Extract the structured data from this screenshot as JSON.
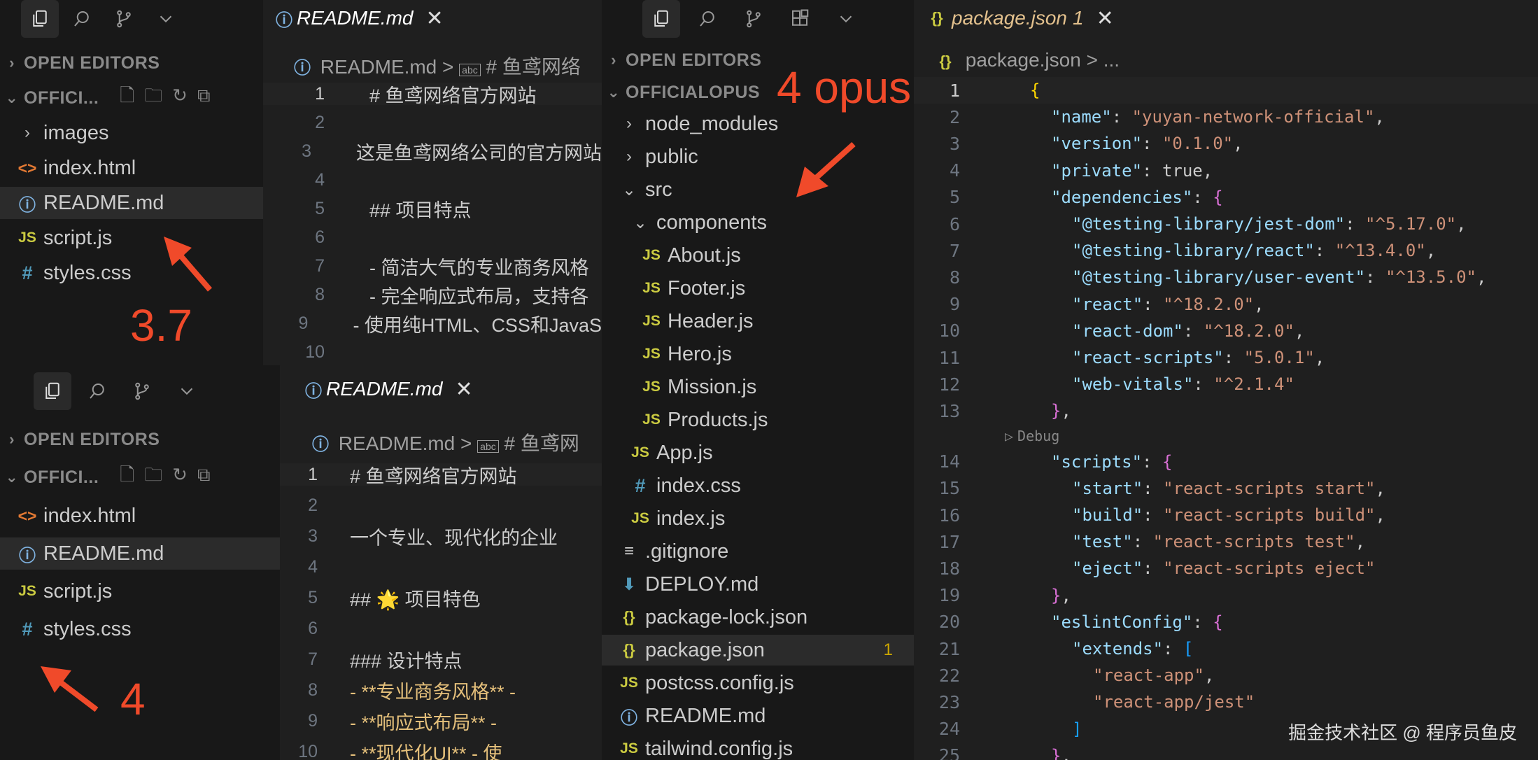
{
  "top_left": {
    "section_open_editors": "OPEN EDITORS",
    "section_folder": "OFFICI...",
    "files": [
      {
        "icon": "folder",
        "label": "images",
        "chev": "›"
      },
      {
        "icon": "html",
        "label": "index.html"
      },
      {
        "icon": "info",
        "label": "README.md",
        "selected": true
      },
      {
        "icon": "js",
        "label": "script.js"
      },
      {
        "icon": "css",
        "label": "styles.css"
      }
    ],
    "annotation": "3.7",
    "tab_label": "README.md",
    "breadcrumb_file": "README.md",
    "breadcrumb_sep": ">",
    "breadcrumb_heading": "# 鱼鸢网络",
    "lines": [
      {
        "n": "1",
        "t": "# 鱼鸢网络官方网站"
      },
      {
        "n": "2",
        "t": ""
      },
      {
        "n": "3",
        "t": "这是鱼鸢网络公司的官方网站"
      },
      {
        "n": "4",
        "t": ""
      },
      {
        "n": "5",
        "t": "## 项目特点"
      },
      {
        "n": "6",
        "t": ""
      },
      {
        "n": "7",
        "t": "- 简洁大气的专业商务风格"
      },
      {
        "n": "8",
        "t": "- 完全响应式布局，支持各"
      },
      {
        "n": "9",
        "t": "- 使用纯HTML、CSS和JavaS"
      },
      {
        "n": "10",
        "t": ""
      }
    ]
  },
  "bottom_left": {
    "section_open_editors": "OPEN EDITORS",
    "section_folder": "OFFICI...",
    "files": [
      {
        "icon": "html",
        "label": "index.html"
      },
      {
        "icon": "info",
        "label": "README.md",
        "selected": true
      },
      {
        "icon": "js",
        "label": "script.js"
      },
      {
        "icon": "css",
        "label": "styles.css"
      }
    ],
    "annotation": "4",
    "tab_label": "README.md",
    "breadcrumb_file": "README.md",
    "breadcrumb_sep": ">",
    "breadcrumb_heading": "# 鱼鸢网",
    "lines": [
      {
        "n": "1",
        "t": "# 鱼鸢网络官方网站"
      },
      {
        "n": "2",
        "t": ""
      },
      {
        "n": "3",
        "t": "一个专业、现代化的企业"
      },
      {
        "n": "4",
        "t": ""
      },
      {
        "n": "5",
        "t": "## 🌟 项目特色"
      },
      {
        "n": "6",
        "t": ""
      },
      {
        "n": "7",
        "t": "### 设计特点"
      },
      {
        "n": "8",
        "t": "- **专业商务风格** -"
      },
      {
        "n": "9",
        "t": "- **响应式布局** -"
      },
      {
        "n": "10",
        "t": "- **现代化UI** - 使"
      }
    ]
  },
  "right": {
    "section_open_editors": "OPEN EDITORS",
    "section_folder": "OFFICIALOPUS",
    "annotation": "4 opus",
    "tree": [
      {
        "icon": "folder",
        "label": "node_modules",
        "chev": "›",
        "depth": 0
      },
      {
        "icon": "folder",
        "label": "public",
        "chev": "›",
        "depth": 0
      },
      {
        "icon": "folder",
        "label": "src",
        "chev": "⌄",
        "depth": 0
      },
      {
        "icon": "folder",
        "label": "components",
        "chev": "⌄",
        "depth": 1
      },
      {
        "icon": "js",
        "label": "About.js",
        "depth": 2
      },
      {
        "icon": "js",
        "label": "Footer.js",
        "depth": 2
      },
      {
        "icon": "js",
        "label": "Header.js",
        "depth": 2
      },
      {
        "icon": "js",
        "label": "Hero.js",
        "depth": 2
      },
      {
        "icon": "js",
        "label": "Mission.js",
        "depth": 2
      },
      {
        "icon": "js",
        "label": "Products.js",
        "depth": 2
      },
      {
        "icon": "js",
        "label": "App.js",
        "depth": 1
      },
      {
        "icon": "css",
        "label": "index.css",
        "depth": 1
      },
      {
        "icon": "js",
        "label": "index.js",
        "depth": 1
      },
      {
        "icon": "git",
        "label": ".gitignore",
        "depth": 0
      },
      {
        "icon": "dl",
        "label": "DEPLOY.md",
        "depth": 0
      },
      {
        "icon": "json",
        "label": "package-lock.json",
        "depth": 0
      },
      {
        "icon": "json",
        "label": "package.json",
        "depth": 0,
        "selected": true,
        "badge": "1"
      },
      {
        "icon": "js",
        "label": "postcss.config.js",
        "depth": 0
      },
      {
        "icon": "info",
        "label": "README.md",
        "depth": 0
      },
      {
        "icon": "js",
        "label": "tailwind.config.js",
        "depth": 0
      }
    ],
    "tab_label": "package.json",
    "tab_badge": "1",
    "breadcrumb_file": "package.json",
    "breadcrumb_sep": ">",
    "breadcrumb_more": "...",
    "codelens": "Debug",
    "json_lines": [
      {
        "n": "1",
        "i": 0,
        "p": [
          [
            "b1",
            "{"
          ]
        ]
      },
      {
        "n": "2",
        "i": 1,
        "p": [
          [
            "k",
            "\"name\""
          ],
          [
            "t",
            ": "
          ],
          [
            "s",
            "\"yuyan-network-official\""
          ],
          [
            "t",
            ","
          ]
        ]
      },
      {
        "n": "3",
        "i": 1,
        "p": [
          [
            "k",
            "\"version\""
          ],
          [
            "t",
            ": "
          ],
          [
            "s",
            "\"0.1.0\""
          ],
          [
            "t",
            ","
          ]
        ]
      },
      {
        "n": "4",
        "i": 1,
        "p": [
          [
            "k",
            "\"private\""
          ],
          [
            "t",
            ": true,"
          ]
        ]
      },
      {
        "n": "5",
        "i": 1,
        "p": [
          [
            "k",
            "\"dependencies\""
          ],
          [
            "t",
            ": "
          ],
          [
            "b2",
            "{"
          ]
        ]
      },
      {
        "n": "6",
        "i": 2,
        "p": [
          [
            "k",
            "\"@testing-library/jest-dom\""
          ],
          [
            "t",
            ": "
          ],
          [
            "s",
            "\"^5.17.0\""
          ],
          [
            "t",
            ","
          ]
        ]
      },
      {
        "n": "7",
        "i": 2,
        "p": [
          [
            "k",
            "\"@testing-library/react\""
          ],
          [
            "t",
            ": "
          ],
          [
            "s",
            "\"^13.4.0\""
          ],
          [
            "t",
            ","
          ]
        ]
      },
      {
        "n": "8",
        "i": 2,
        "p": [
          [
            "k",
            "\"@testing-library/user-event\""
          ],
          [
            "t",
            ": "
          ],
          [
            "s",
            "\"^13.5.0\""
          ],
          [
            "t",
            ","
          ]
        ]
      },
      {
        "n": "9",
        "i": 2,
        "p": [
          [
            "k",
            "\"react\""
          ],
          [
            "t",
            ": "
          ],
          [
            "s",
            "\"^18.2.0\""
          ],
          [
            "t",
            ","
          ]
        ]
      },
      {
        "n": "10",
        "i": 2,
        "p": [
          [
            "k",
            "\"react-dom\""
          ],
          [
            "t",
            ": "
          ],
          [
            "s",
            "\"^18.2.0\""
          ],
          [
            "t",
            ","
          ]
        ]
      },
      {
        "n": "11",
        "i": 2,
        "p": [
          [
            "k",
            "\"react-scripts\""
          ],
          [
            "t",
            ": "
          ],
          [
            "s",
            "\"5.0.1\""
          ],
          [
            "t",
            ","
          ]
        ]
      },
      {
        "n": "12",
        "i": 2,
        "p": [
          [
            "k",
            "\"web-vitals\""
          ],
          [
            "t",
            ": "
          ],
          [
            "s",
            "\"^2.1.4\""
          ]
        ]
      },
      {
        "n": "13",
        "i": 1,
        "p": [
          [
            "b2",
            "}"
          ],
          [
            "t",
            ","
          ]
        ]
      },
      {
        "n": "14",
        "i": 1,
        "p": [
          [
            "k",
            "\"scripts\""
          ],
          [
            "t",
            ": "
          ],
          [
            "b2",
            "{"
          ]
        ]
      },
      {
        "n": "15",
        "i": 2,
        "p": [
          [
            "k",
            "\"start\""
          ],
          [
            "t",
            ": "
          ],
          [
            "s",
            "\"react-scripts start\""
          ],
          [
            "t",
            ","
          ]
        ]
      },
      {
        "n": "16",
        "i": 2,
        "p": [
          [
            "k",
            "\"build\""
          ],
          [
            "t",
            ": "
          ],
          [
            "s",
            "\"react-scripts build\""
          ],
          [
            "t",
            ","
          ]
        ]
      },
      {
        "n": "17",
        "i": 2,
        "p": [
          [
            "k",
            "\"test\""
          ],
          [
            "t",
            ": "
          ],
          [
            "s",
            "\"react-scripts test\""
          ],
          [
            "t",
            ","
          ]
        ]
      },
      {
        "n": "18",
        "i": 2,
        "p": [
          [
            "k",
            "\"eject\""
          ],
          [
            "t",
            ": "
          ],
          [
            "s",
            "\"react-scripts eject\""
          ]
        ]
      },
      {
        "n": "19",
        "i": 1,
        "p": [
          [
            "b2",
            "}"
          ],
          [
            "t",
            ","
          ]
        ]
      },
      {
        "n": "20",
        "i": 1,
        "p": [
          [
            "k",
            "\"eslintConfig\""
          ],
          [
            "t",
            ": "
          ],
          [
            "b2",
            "{"
          ]
        ]
      },
      {
        "n": "21",
        "i": 2,
        "p": [
          [
            "k",
            "\"extends\""
          ],
          [
            "t",
            ": "
          ],
          [
            "b3",
            "["
          ]
        ]
      },
      {
        "n": "22",
        "i": 3,
        "p": [
          [
            "s",
            "\"react-app\""
          ],
          [
            "t",
            ","
          ]
        ]
      },
      {
        "n": "23",
        "i": 3,
        "p": [
          [
            "s",
            "\"react-app/jest\""
          ]
        ]
      },
      {
        "n": "24",
        "i": 2,
        "p": [
          [
            "b3",
            "]"
          ]
        ]
      },
      {
        "n": "25",
        "i": 1,
        "p": [
          [
            "b2",
            "}"
          ],
          [
            "t",
            ","
          ]
        ]
      }
    ]
  },
  "watermark": "掘金技术社区 @ 程序员鱼皮",
  "colors": {
    "annotation": "#f04a2a",
    "background": "#181818",
    "selection": "#2b2b2b"
  }
}
